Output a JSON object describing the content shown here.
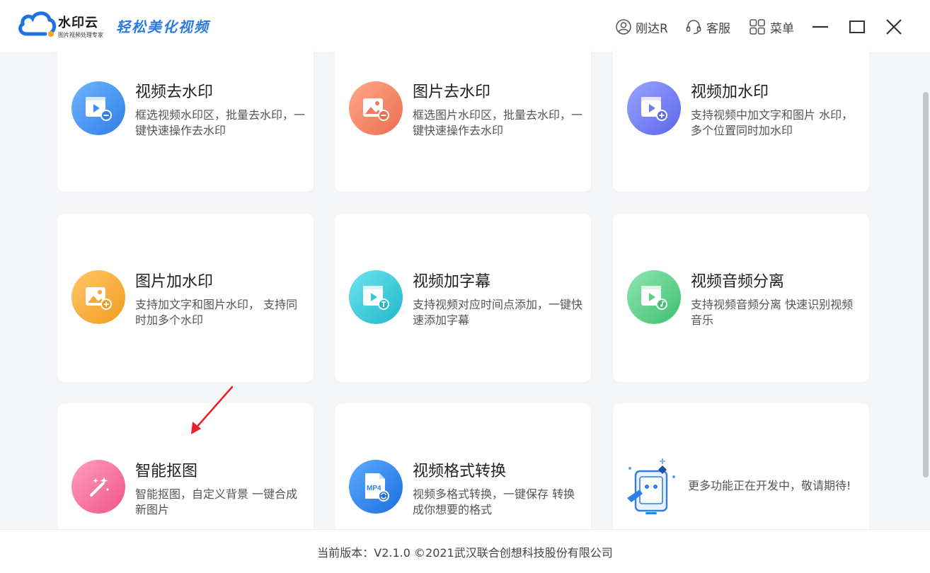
{
  "app": {
    "logo_title": "水印云",
    "logo_sub": "图片视频处理专家",
    "slogan": "轻松美化视频"
  },
  "header": {
    "user": "刚达R",
    "service": "客服",
    "menu": "菜单"
  },
  "cards": [
    {
      "title": "视频去水印",
      "desc": "框选视频水印区，批量去水印，一键快速操作去水印",
      "icon": "video-remove-icon",
      "color": "#3f8ff0"
    },
    {
      "title": "图片去水印",
      "desc": "框选图片水印区，批量去水印，一键快速操作去水印",
      "icon": "image-remove-icon",
      "color": "#f07b5d"
    },
    {
      "title": "视频加水印",
      "desc": "支持视频中加文字和图片 水印，多个位置同时加水印",
      "icon": "video-add-icon",
      "color": "#6f7cf0"
    },
    {
      "title": "图片加水印",
      "desc": "支持加文字和图片水印， 支持同时加多个水印",
      "icon": "image-add-icon",
      "color": "#f7a73a"
    },
    {
      "title": "视频加字幕",
      "desc": "支持视频对应时间点添加，一键快速添加字幕",
      "icon": "video-subtitle-icon",
      "color": "#36c9d6"
    },
    {
      "title": "视频音频分离",
      "desc": "支持视频音频分离 快速识别视频音乐",
      "icon": "video-audio-icon",
      "color": "#5ccf8a"
    },
    {
      "title": "智能抠图",
      "desc": "智能抠图，自定义背景 一键合成新图片",
      "icon": "magic-wand-icon",
      "color": "#f46a96"
    },
    {
      "title": "视频格式转换",
      "desc": "视频多格式转换，一键保存 转换成你想要的格式",
      "icon": "mp4-convert-icon",
      "color": "#2f86ea",
      "badge": "MP4"
    }
  ],
  "more": {
    "text": "更多功能正在开发中，敬请期待!"
  },
  "footer": {
    "text": "当前版本：V2.1.0 ©2021武汉联合创想科技股份有限公司"
  },
  "colors": {
    "accent": "#2a7be0",
    "arrow": "#e8202a"
  }
}
